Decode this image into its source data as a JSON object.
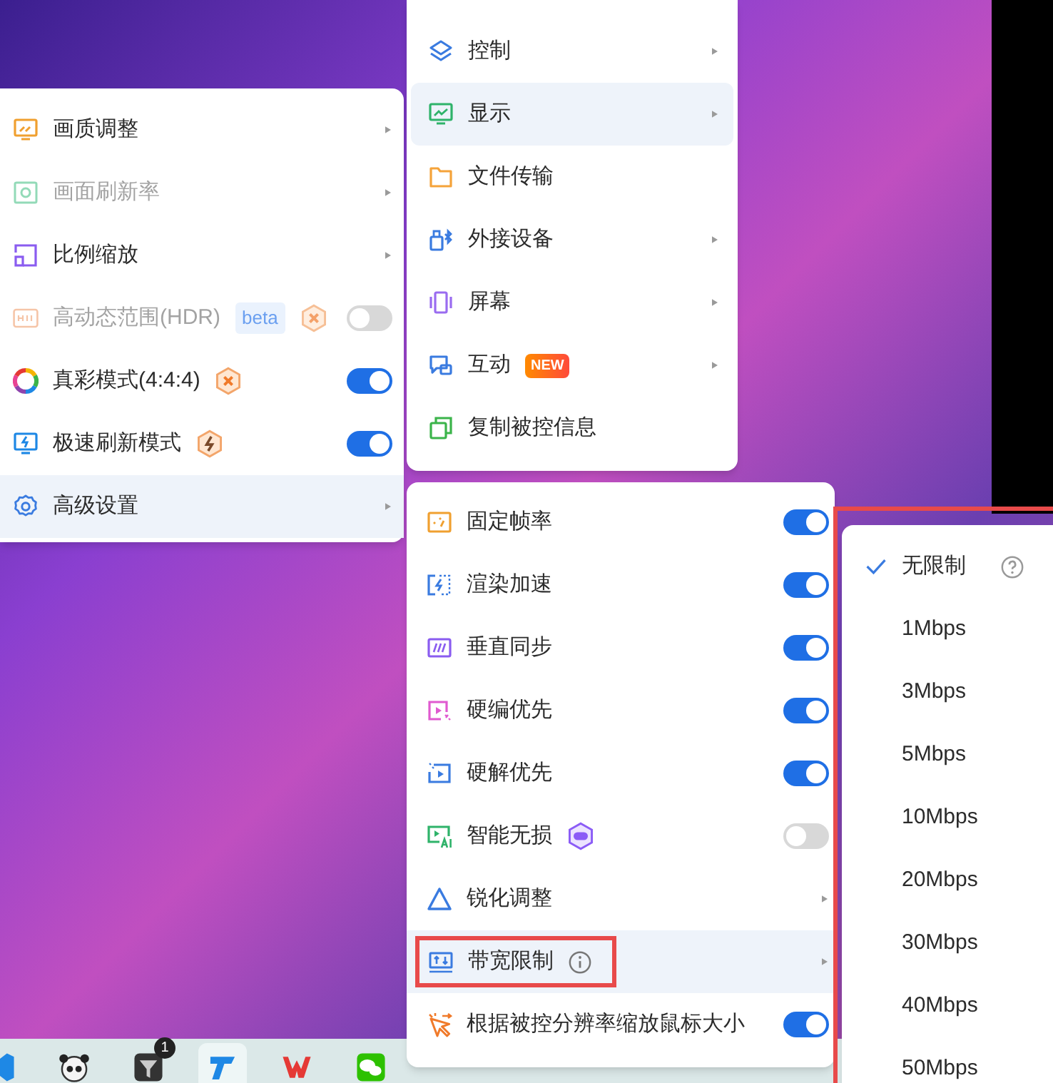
{
  "left_menu": {
    "items": [
      {
        "kind": "submenu",
        "label": "画质调整",
        "disabled": false,
        "selected": false
      },
      {
        "kind": "submenu",
        "label": "画面刷新率",
        "disabled": true,
        "selected": false
      },
      {
        "kind": "submenu",
        "label": "比例缩放",
        "disabled": false,
        "selected": false
      },
      {
        "kind": "toggle",
        "label": "高动态范围(HDR)",
        "tag": "beta",
        "disabled": true,
        "on": false,
        "selected": false
      },
      {
        "kind": "toggle",
        "label": "真彩模式(4:4:4)",
        "disabled": false,
        "on": true,
        "selected": false
      },
      {
        "kind": "toggle",
        "label": "极速刷新模式",
        "disabled": false,
        "on": true,
        "selected": false
      },
      {
        "kind": "submenu",
        "label": "高级设置",
        "disabled": false,
        "selected": true
      }
    ]
  },
  "middle_menu": {
    "items": [
      {
        "kind": "submenu",
        "label": "控制",
        "selected": false
      },
      {
        "kind": "submenu",
        "label": "显示",
        "selected": true
      },
      {
        "kind": "action",
        "label": "文件传输",
        "selected": false
      },
      {
        "kind": "submenu",
        "label": "外接设备",
        "selected": false
      },
      {
        "kind": "submenu",
        "label": "屏幕",
        "selected": false
      },
      {
        "kind": "submenu",
        "label": "互动",
        "tag": "NEW",
        "selected": false
      },
      {
        "kind": "action",
        "label": "复制被控信息",
        "selected": false
      }
    ]
  },
  "advanced_menu": {
    "items": [
      {
        "kind": "toggle",
        "label": "固定帧率",
        "on": true,
        "selected": false,
        "outlined": false
      },
      {
        "kind": "toggle",
        "label": "渲染加速",
        "on": true,
        "selected": false,
        "outlined": false
      },
      {
        "kind": "toggle",
        "label": "垂直同步",
        "on": true,
        "selected": false,
        "outlined": false
      },
      {
        "kind": "toggle",
        "label": "硬编优先",
        "on": true,
        "selected": false,
        "outlined": false
      },
      {
        "kind": "toggle",
        "label": "硬解优先",
        "on": true,
        "selected": false,
        "outlined": false
      },
      {
        "kind": "toggle",
        "label": "智能无损",
        "on": false,
        "selected": false,
        "outlined": false
      },
      {
        "kind": "submenu",
        "label": "锐化调整",
        "selected": false,
        "outlined": false
      },
      {
        "kind": "submenu",
        "label": "带宽限制",
        "selected": true,
        "outlined": true
      },
      {
        "kind": "toggle",
        "label": "根据被控分辨率缩放鼠标大小",
        "on": true,
        "selected": false,
        "outlined": false
      }
    ]
  },
  "bandwidth_menu": {
    "outlined": true,
    "items": [
      {
        "label": "无限制",
        "selected": true
      },
      {
        "label": "1Mbps",
        "selected": false
      },
      {
        "label": "3Mbps",
        "selected": false
      },
      {
        "label": "5Mbps",
        "selected": false
      },
      {
        "label": "10Mbps",
        "selected": false
      },
      {
        "label": "20Mbps",
        "selected": false
      },
      {
        "label": "30Mbps",
        "selected": false
      },
      {
        "label": "40Mbps",
        "selected": false
      },
      {
        "label": "50Mbps",
        "selected": false
      }
    ]
  },
  "taskbar": {
    "items": [
      {
        "selected": false
      },
      {
        "selected": false
      },
      {
        "selected": false,
        "badge": "1"
      },
      {
        "selected": true
      },
      {
        "selected": false
      },
      {
        "selected": false
      }
    ]
  }
}
